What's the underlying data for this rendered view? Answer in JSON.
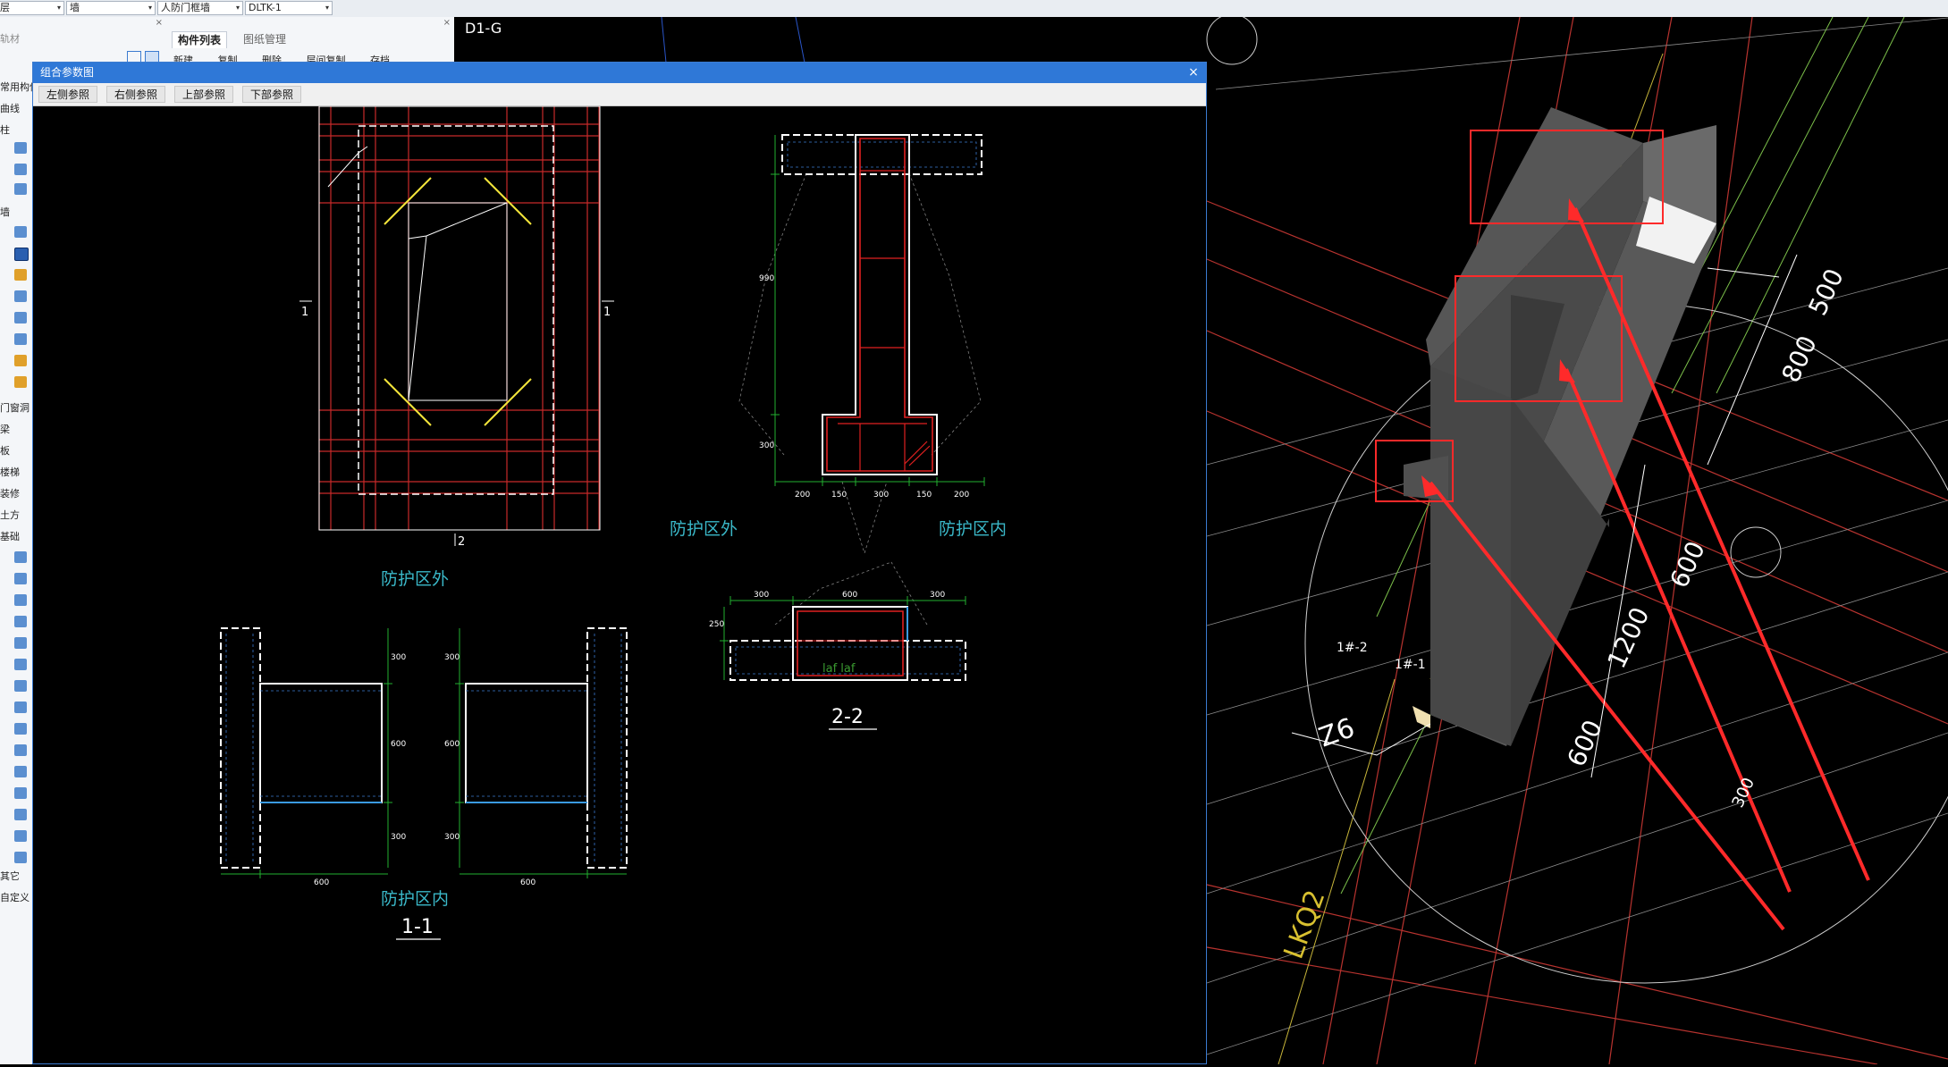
{
  "filters": [
    {
      "value": "层",
      "arrow": "▾"
    },
    {
      "value": "墙",
      "arrow": "▾"
    },
    {
      "value": "人防门框墙",
      "arrow": "▾"
    },
    {
      "value": "DLTK-1",
      "arrow": "▾"
    }
  ],
  "left_nav": {
    "partial_top": "轨材",
    "items": [
      "常用构件",
      "曲线",
      "柱",
      "墙",
      "门窗洞",
      "梁",
      "板",
      "楼梯",
      "装修",
      "土方",
      "基础",
      "其它",
      "自定义"
    ]
  },
  "component_panel": {
    "tabs": [
      "构件列表",
      "图纸管理"
    ],
    "toolbar": [
      "新建",
      "复制",
      "删除",
      "层间复制",
      "存档"
    ]
  },
  "canvas": {
    "grid_label": "D1-G",
    "labels": [
      "1#-2",
      "1#-1",
      "Z6",
      "LKQ2"
    ],
    "dims": [
      "500",
      "800",
      "600",
      "1200",
      "600",
      "300"
    ]
  },
  "dialog": {
    "title": "组合参数图",
    "close_icon": "×",
    "toolbar": [
      "左侧参照",
      "右侧参照",
      "上部参照",
      "下部参照"
    ],
    "elevation": {
      "marks": [
        "1",
        "1",
        "2"
      ]
    },
    "section_22_top": {
      "dims_bottom": [
        "200",
        "150",
        "300",
        "150",
        "200"
      ],
      "dims_left": [
        "990",
        "300"
      ]
    },
    "section_22_bottom": {
      "outside_label": "防护区外",
      "inside_label": "防护区内",
      "dims_top": [
        "300",
        "600",
        "300"
      ],
      "dim_left": "250",
      "anchor_text": "laf  laf",
      "title": "2-2"
    },
    "section_11": {
      "outside_label": "防护区外",
      "inside_label": "防护区内",
      "dims_side": [
        "300",
        "600",
        "300"
      ],
      "dim_bottom": "600",
      "title": "1-1"
    }
  }
}
